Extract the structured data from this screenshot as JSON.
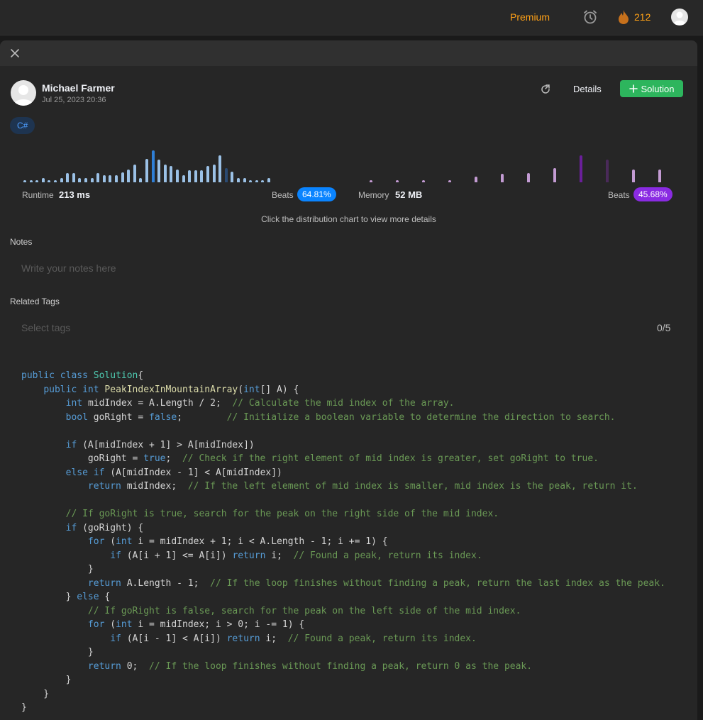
{
  "nav": {
    "premium_label": "Premium",
    "streak_count": "212"
  },
  "submission": {
    "author_name": "Michael Farmer",
    "date": "Jul 25, 2023 20:36",
    "details_label": "Details",
    "solution_label": "Solution",
    "language": "C#"
  },
  "metrics": {
    "runtime_label": "Runtime",
    "runtime_value": "213 ms",
    "runtime_beats_label": "Beats",
    "runtime_beats": "64.81%",
    "memory_label": "Memory",
    "memory_value": "52 MB",
    "memory_beats_label": "Beats",
    "memory_beats": "45.68%",
    "hint": "Click the distribution chart to view more details"
  },
  "runtime_distribution": {
    "bar_heights": [
      3,
      3,
      3,
      6,
      3,
      3,
      6,
      13,
      13,
      6,
      6,
      6,
      13,
      10,
      10,
      10,
      14,
      18,
      25,
      6,
      33,
      45,
      32,
      25,
      23,
      18,
      10,
      17,
      17,
      17,
      23,
      25,
      38,
      20,
      15,
      6,
      6,
      3,
      3,
      3,
      6
    ],
    "highlight_index": 33,
    "selected_index": 21
  },
  "memory_distribution": {
    "bar_heights": [
      3,
      3,
      3,
      3,
      8,
      12,
      13,
      20,
      38,
      32,
      18,
      18
    ],
    "highlight_indices": [
      8,
      9
    ]
  },
  "notes": {
    "label": "Notes",
    "placeholder": "Write your notes here"
  },
  "tags": {
    "label": "Related Tags",
    "placeholder": "Select tags",
    "count": "0/5"
  },
  "code_lines": [
    [
      [
        "kw",
        "public "
      ],
      [
        "kw",
        "class "
      ],
      [
        "ty",
        "Solution"
      ],
      [
        "",
        "{"
      ]
    ],
    [
      [
        "",
        "    "
      ],
      [
        "kw",
        "public "
      ],
      [
        "kw",
        "int "
      ],
      [
        "fn",
        "PeakIndexInMountainArray"
      ],
      [
        "",
        "("
      ],
      [
        "kw",
        "int"
      ],
      [
        "",
        "[] A) {"
      ]
    ],
    [
      [
        "",
        "        "
      ],
      [
        "kw",
        "int "
      ],
      [
        "",
        "midIndex = A.Length / 2;  "
      ],
      [
        "cm",
        "// Calculate the mid index of the array."
      ]
    ],
    [
      [
        "",
        "        "
      ],
      [
        "kw",
        "bool "
      ],
      [
        "",
        "goRight = "
      ],
      [
        "kw",
        "false"
      ],
      [
        "",
        ";        "
      ],
      [
        "cm",
        "// Initialize a boolean variable to determine the direction to search."
      ]
    ],
    [
      [
        "",
        ""
      ]
    ],
    [
      [
        "",
        "        "
      ],
      [
        "kw",
        "if "
      ],
      [
        "",
        "(A[midIndex + 1] > A[midIndex])"
      ]
    ],
    [
      [
        "",
        "            goRight = "
      ],
      [
        "kw",
        "true"
      ],
      [
        "",
        ";  "
      ],
      [
        "cm",
        "// Check if the right element of mid index is greater, set goRight to true."
      ]
    ],
    [
      [
        "",
        "        "
      ],
      [
        "kw",
        "else if "
      ],
      [
        "",
        "(A[midIndex - 1] < A[midIndex])"
      ]
    ],
    [
      [
        "",
        "            "
      ],
      [
        "kw",
        "return "
      ],
      [
        "",
        "midIndex;  "
      ],
      [
        "cm",
        "// If the left element of mid index is smaller, mid index is the peak, return it."
      ]
    ],
    [
      [
        "",
        ""
      ]
    ],
    [
      [
        "",
        "        "
      ],
      [
        "cm",
        "// If goRight is true, search for the peak on the right side of the mid index."
      ]
    ],
    [
      [
        "",
        "        "
      ],
      [
        "kw",
        "if "
      ],
      [
        "",
        "(goRight) {"
      ]
    ],
    [
      [
        "",
        "            "
      ],
      [
        "kw",
        "for "
      ],
      [
        "",
        "("
      ],
      [
        "kw",
        "int "
      ],
      [
        "",
        "i = midIndex + 1; i < A.Length - 1; i += 1) {"
      ]
    ],
    [
      [
        "",
        "                "
      ],
      [
        "kw",
        "if "
      ],
      [
        "",
        "(A[i + 1] <= A[i]) "
      ],
      [
        "kw",
        "return "
      ],
      [
        "",
        "i;  "
      ],
      [
        "cm",
        "// Found a peak, return its index."
      ]
    ],
    [
      [
        "",
        "            }"
      ]
    ],
    [
      [
        "",
        "            "
      ],
      [
        "kw",
        "return "
      ],
      [
        "",
        "A.Length - 1;  "
      ],
      [
        "cm",
        "// If the loop finishes without finding a peak, return the last index as the peak."
      ]
    ],
    [
      [
        "",
        "        } "
      ],
      [
        "kw",
        "else "
      ],
      [
        "",
        "{"
      ]
    ],
    [
      [
        "",
        "            "
      ],
      [
        "cm",
        "// If goRight is false, search for the peak on the left side of the mid index."
      ]
    ],
    [
      [
        "",
        "            "
      ],
      [
        "kw",
        "for "
      ],
      [
        "",
        "("
      ],
      [
        "kw",
        "int "
      ],
      [
        "",
        "i = midIndex; i > 0; i -= 1) {"
      ]
    ],
    [
      [
        "",
        "                "
      ],
      [
        "kw",
        "if "
      ],
      [
        "",
        "(A[i - 1] < A[i]) "
      ],
      [
        "kw",
        "return "
      ],
      [
        "",
        "i;  "
      ],
      [
        "cm",
        "// Found a peak, return its index."
      ]
    ],
    [
      [
        "",
        "            }"
      ]
    ],
    [
      [
        "",
        "            "
      ],
      [
        "kw",
        "return "
      ],
      [
        "",
        "0;  "
      ],
      [
        "cm",
        "// If the loop finishes without finding a peak, return 0 as the peak."
      ]
    ],
    [
      [
        "",
        "        }"
      ]
    ],
    [
      [
        "",
        "    }"
      ]
    ],
    [
      [
        "",
        "}"
      ]
    ]
  ],
  "colors": {
    "accent_orange": "#ffa116",
    "runtime_bar": "#9bc1e6",
    "runtime_pill": "#0a84ff",
    "memory_bar": "#c39bd3",
    "memory_pill": "#8a2be2",
    "solution_button": "#2db55d"
  }
}
